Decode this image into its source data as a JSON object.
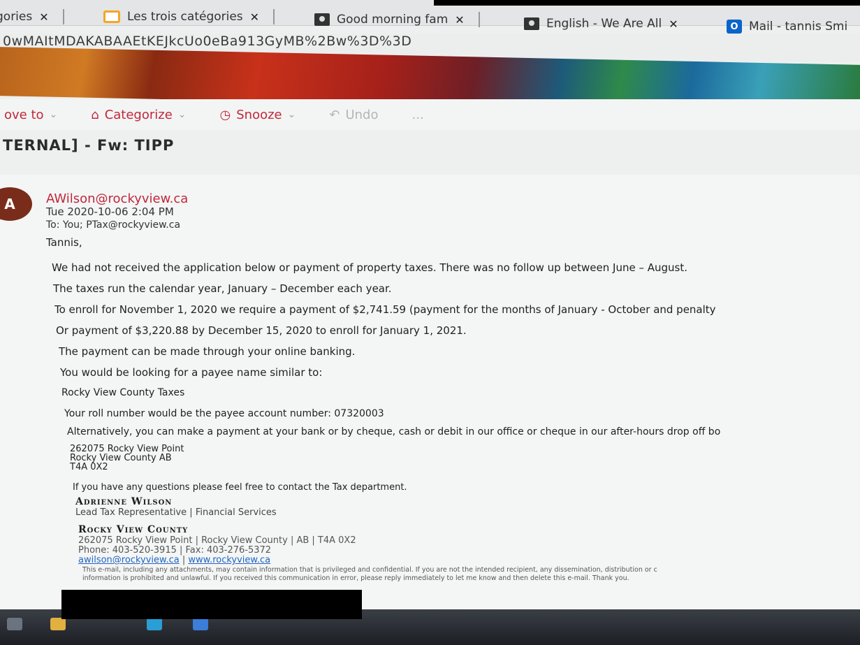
{
  "tabs": [
    {
      "label": "gories"
    },
    {
      "label": "Les trois catégories"
    },
    {
      "label": "Good morning fam"
    },
    {
      "label": "English - We Are All"
    },
    {
      "label": "Mail - tannis Smi"
    }
  ],
  "url": "0wMAItMDAKABAAEtKEJkcUo0eBa913GyMB%2Bw%3D%3D",
  "toolbar": {
    "move_to": "ove to",
    "categorize": "Categorize",
    "snooze": "Snooze",
    "undo": "Undo",
    "more": "..."
  },
  "email": {
    "subject": "TERNAL] - Fw: TIPP",
    "avatar_letter": "A",
    "sender": "AWilson@rockyview.ca",
    "date": "Tue 2020-10-06 2:04 PM",
    "recipients": "To:  You; PTax@rockyview.ca",
    "greeting": "Tannis,",
    "body": [
      "We had not received the application below or payment of property taxes. There was no follow up between June – August.",
      "The taxes run the calendar year, January – December each year.",
      "To enroll for November 1, 2020 we require a payment of $2,741.59 (payment for the months of January - October and penalty",
      "Or payment of $3,220.88 by December 15, 2020 to enroll for January 1, 2021.",
      "The payment can be made through your online banking.",
      "You would be looking for a payee name similar to:",
      "Rocky View County Taxes",
      "Your roll number would be the payee account number: 07320003",
      "Alternatively, you can make a payment at your bank or by cheque, cash or debit in our office or cheque in our after-hours drop off bo"
    ],
    "address": [
      "262075 Rocky View Point",
      "Rocky View County AB",
      "T4A 0X2"
    ],
    "closing": "If you have any questions please feel free to contact the Tax department.",
    "signature": {
      "name": "Adrienne Wilson",
      "title": "Lead Tax Representative | Financial Services",
      "org": "Rocky View County",
      "address_line": "262075 Rocky View Point | Rocky View County | AB | T4A 0X2",
      "phone_line": "Phone: 403-520-3915 | Fax: 403-276-5372",
      "email": "awilson@rockyview.ca",
      "sep": " | ",
      "website": "www.rockyview.ca"
    },
    "disclaimer": [
      "This e-mail, including any attachments, may contain information that is privileged and confidential. If you are not the intended recipient, any dissemination, distribution or c",
      "information is prohibited and unlawful.  If you received this communication in error, please reply immediately to let me know and then delete this e-mail.  Thank you."
    ]
  },
  "colors": {
    "accent": "#c0283b",
    "link": "#2266c2"
  }
}
